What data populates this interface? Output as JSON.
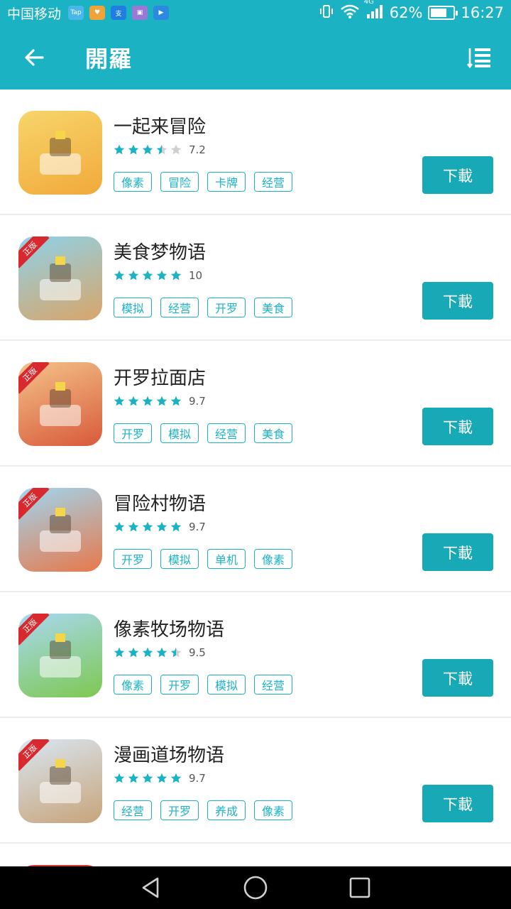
{
  "status_bar": {
    "carrier": "中国移动",
    "mini_icons": [
      {
        "name": "taptap-icon",
        "text": "Tap",
        "color": "#49b8e8"
      },
      {
        "name": "heart-app-icon",
        "text": "♥",
        "color": "#f0a23b"
      },
      {
        "name": "alipay-icon",
        "text": "支",
        "color": "#1f7fe0"
      },
      {
        "name": "gallery-icon",
        "text": "▣",
        "color": "#9a79d6"
      },
      {
        "name": "video-icon",
        "text": "▶",
        "color": "#2b8ae0"
      }
    ],
    "network": "4G",
    "battery": "62%",
    "battery_level": 0.62,
    "time": "16:27"
  },
  "header": {
    "title": "開羅"
  },
  "colors": {
    "accent": "#1bb3c4",
    "button": "#18a9b7",
    "star_empty": "#cfcfcf"
  },
  "games": [
    {
      "title": "一起来冒险",
      "score": "7.2",
      "stars": 3.5,
      "tags": [
        "像素",
        "冒险",
        "卡牌",
        "经营"
      ],
      "button": "下載",
      "icon_colors": [
        "#f7d56a",
        "#f2a93b"
      ]
    },
    {
      "title": "美食梦物语",
      "score": "10",
      "stars": 5,
      "tags": [
        "模拟",
        "经营",
        "开罗",
        "美食"
      ],
      "button": "下載",
      "icon_colors": [
        "#8fd2e8",
        "#d9a56a"
      ]
    },
    {
      "title": "开罗拉面店",
      "score": "9.7",
      "stars": 5,
      "tags": [
        "开罗",
        "模拟",
        "经营",
        "美食"
      ],
      "button": "下載",
      "icon_colors": [
        "#f4c28a",
        "#d85a3a"
      ]
    },
    {
      "title": "冒险村物语",
      "score": "9.7",
      "stars": 5,
      "tags": [
        "开罗",
        "模拟",
        "单机",
        "像素"
      ],
      "button": "下載",
      "icon_colors": [
        "#9fd6f0",
        "#e8784a"
      ]
    },
    {
      "title": "像素牧场物语",
      "score": "9.5",
      "stars": 4.5,
      "tags": [
        "像素",
        "开罗",
        "模拟",
        "经营"
      ],
      "button": "下載",
      "icon_colors": [
        "#a8d8f2",
        "#7ec850"
      ]
    },
    {
      "title": "漫画道场物语",
      "score": "9.7",
      "stars": 5,
      "tags": [
        "经营",
        "开罗",
        "养成",
        "像素"
      ],
      "button": "下載",
      "icon_colors": [
        "#d8e6f2",
        "#c8a47a"
      ]
    }
  ],
  "badge_text": "正版"
}
